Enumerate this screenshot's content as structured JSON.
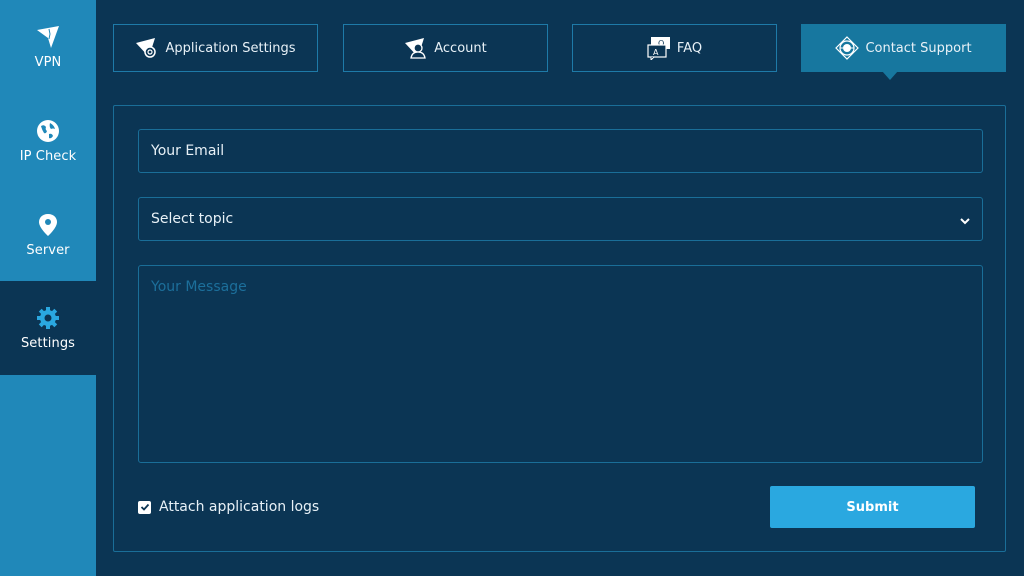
{
  "sidebar": {
    "items": [
      {
        "label": "VPN",
        "icon": "vpn-logo-icon",
        "active": false
      },
      {
        "label": "IP Check",
        "icon": "globe-icon",
        "active": false
      },
      {
        "label": "Server",
        "icon": "map-pin-icon",
        "active": false
      },
      {
        "label": "Settings",
        "icon": "gear-icon",
        "active": true
      }
    ]
  },
  "tabs": [
    {
      "label": "Application Settings",
      "icon": "app-settings-icon",
      "active": false
    },
    {
      "label": "Account",
      "icon": "account-icon",
      "active": false
    },
    {
      "label": "FAQ",
      "icon": "faq-icon",
      "active": false
    },
    {
      "label": "Contact Support",
      "icon": "lifebuoy-icon",
      "active": true
    }
  ],
  "form": {
    "email_placeholder": "Your Email",
    "topic_selected": "Select topic",
    "message_placeholder": "Your Message",
    "attach_logs_label": "Attach application logs",
    "attach_logs_checked": true,
    "submit_label": "Submit"
  },
  "colors": {
    "background": "#0b3554",
    "sidebar": "#2088b9",
    "active_tab": "#17779f",
    "border": "#1a6e98",
    "submit": "#2aa8e0",
    "settings_icon": "#2aa8e0"
  }
}
